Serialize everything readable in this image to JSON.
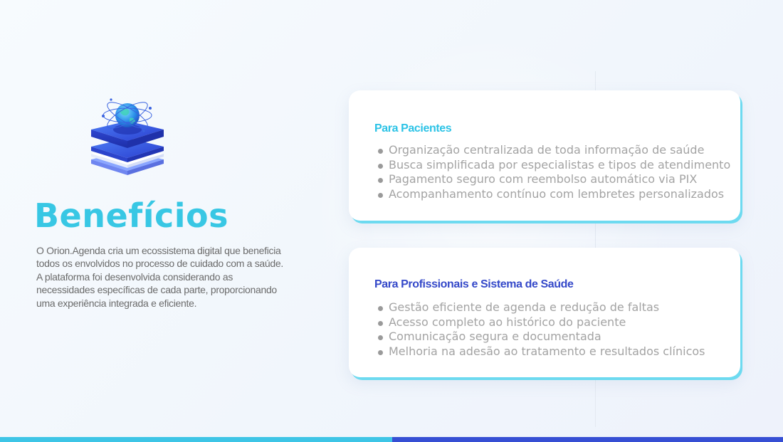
{
  "title": "Benefícios",
  "description": "O Orion.Agenda cria um ecossistema digital que beneficia todos os envolvidos no processo de cuidado com a saúde. A plataforma foi desenvolvida considerando as necessidades específicas de cada parte, proporcionando uma experiência integrada e eficiente.",
  "logo_icon": "globe-stack-icon",
  "cards": [
    {
      "title": "Para Pacientes",
      "items": [
        "Organização centralizada de toda informação de saúde",
        "Busca simplificada por especialistas e tipos de atendimento",
        "Pagamento seguro com reembolso automático via PIX",
        "Acompanhamento contínuo com lembretes personalizados"
      ]
    },
    {
      "title": "Para Profissionais e Sistema de Saúde",
      "items": [
        "Gestão eficiente de agenda e redução de faltas",
        "Acesso completo ao histórico do paciente",
        "Comunicação segura e documentada",
        "Melhoria na adesão ao tratamento e resultados clínicos"
      ]
    }
  ],
  "colors": {
    "accent_cyan": "#38c7e4",
    "accent_blue": "#364fd4",
    "text_gray": "#6b6b6b",
    "bullet_gray": "#a3a3a3"
  }
}
